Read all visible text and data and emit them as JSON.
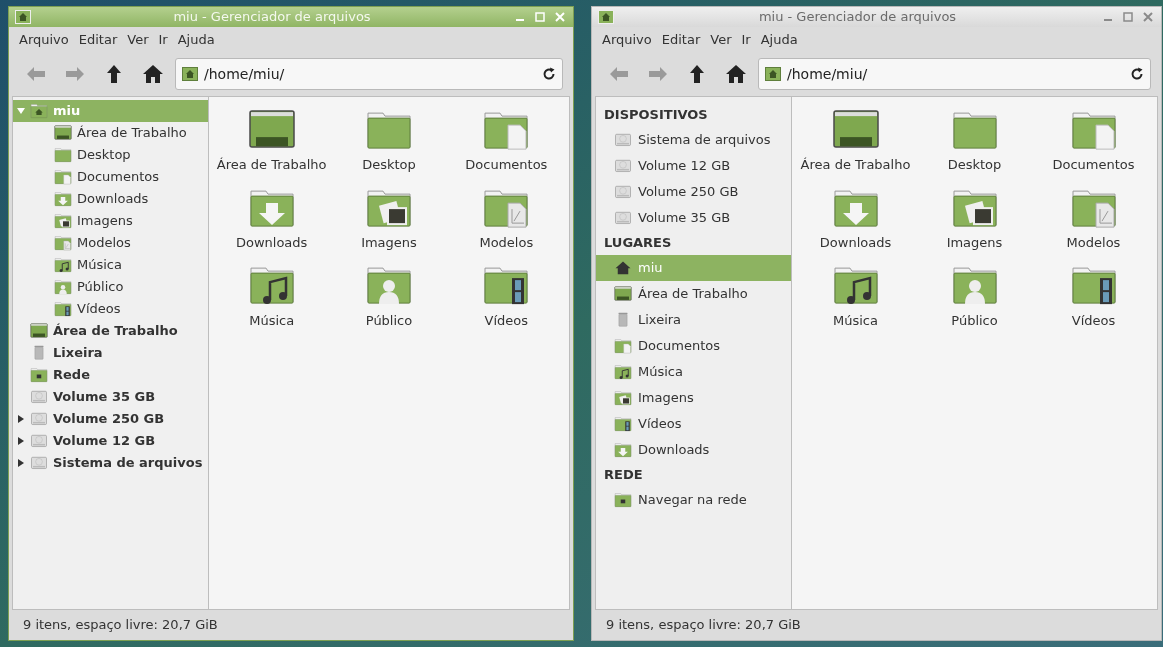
{
  "windows": [
    {
      "active": true,
      "title": "miu - Gerenciador de arquivos",
      "menu": [
        "Arquivo",
        "Editar",
        "Ver",
        "Ir",
        "Ajuda"
      ],
      "path": "/home/miu/",
      "sidebar": {
        "kind": "tree",
        "items": [
          {
            "label": "miu",
            "kind": "home",
            "selected": true,
            "expanded": true,
            "children": [
              {
                "label": "Área de Trabalho",
                "kind": "desktop",
                "selected": false
              },
              {
                "label": "Desktop",
                "kind": "folder",
                "selected": false
              },
              {
                "label": "Documentos",
                "kind": "documents",
                "selected": false
              },
              {
                "label": "Downloads",
                "kind": "downloads",
                "selected": false
              },
              {
                "label": "Imagens",
                "kind": "pictures",
                "selected": false
              },
              {
                "label": "Modelos",
                "kind": "templates",
                "selected": false
              },
              {
                "label": "Música",
                "kind": "music",
                "selected": false
              },
              {
                "label": "Público",
                "kind": "public",
                "selected": false
              },
              {
                "label": "Vídeos",
                "kind": "videos",
                "selected": false
              }
            ]
          },
          {
            "label": "Área de Trabalho",
            "kind": "desktop",
            "selected": false
          },
          {
            "label": "Lixeira",
            "kind": "trash",
            "selected": false
          },
          {
            "label": "Rede",
            "kind": "network",
            "selected": false
          },
          {
            "label": "Volume 35 GB",
            "kind": "drive",
            "selected": false
          },
          {
            "label": "Volume 250 GB",
            "kind": "drive",
            "selected": false,
            "expanded": false
          },
          {
            "label": "Volume 12 GB",
            "kind": "drive",
            "selected": false,
            "expanded": false
          },
          {
            "label": "Sistema de arquivos",
            "kind": "drive",
            "selected": false,
            "expanded": false
          }
        ]
      },
      "files": [
        {
          "label": "Área de Trabalho",
          "kind": "desktop"
        },
        {
          "label": "Desktop",
          "kind": "folder"
        },
        {
          "label": "Documentos",
          "kind": "documents"
        },
        {
          "label": "Downloads",
          "kind": "downloads"
        },
        {
          "label": "Imagens",
          "kind": "pictures"
        },
        {
          "label": "Modelos",
          "kind": "templates"
        },
        {
          "label": "Música",
          "kind": "music"
        },
        {
          "label": "Público",
          "kind": "public"
        },
        {
          "label": "Vídeos",
          "kind": "videos"
        }
      ],
      "status": "9 itens, espaço livre: 20,7 GiB"
    },
    {
      "active": false,
      "title": "miu - Gerenciador de arquivos",
      "menu": [
        "Arquivo",
        "Editar",
        "Ver",
        "Ir",
        "Ajuda"
      ],
      "path": "/home/miu/",
      "sidebar": {
        "kind": "places",
        "sections": [
          {
            "heading": "DISPOSITIVOS",
            "items": [
              {
                "label": "Sistema de arquivos",
                "kind": "drive",
                "selected": false
              },
              {
                "label": "Volume 12 GB",
                "kind": "drive",
                "selected": false
              },
              {
                "label": "Volume 250 GB",
                "kind": "drive",
                "selected": false
              },
              {
                "label": "Volume 35 GB",
                "kind": "drive",
                "selected": false
              }
            ]
          },
          {
            "heading": "LUGARES",
            "items": [
              {
                "label": "miu",
                "kind": "home_arrow",
                "selected": true
              },
              {
                "label": "Área de Trabalho",
                "kind": "desktop",
                "selected": false
              },
              {
                "label": "Lixeira",
                "kind": "trash",
                "selected": false
              },
              {
                "label": "Documentos",
                "kind": "documents",
                "selected": false
              },
              {
                "label": "Música",
                "kind": "music",
                "selected": false
              },
              {
                "label": "Imagens",
                "kind": "pictures",
                "selected": false
              },
              {
                "label": "Vídeos",
                "kind": "videos",
                "selected": false
              },
              {
                "label": "Downloads",
                "kind": "downloads",
                "selected": false
              }
            ]
          },
          {
            "heading": "REDE",
            "items": [
              {
                "label": "Navegar na rede",
                "kind": "network",
                "selected": false
              }
            ]
          }
        ]
      },
      "files": [
        {
          "label": "Área de Trabalho",
          "kind": "desktop"
        },
        {
          "label": "Desktop",
          "kind": "folder"
        },
        {
          "label": "Documentos",
          "kind": "documents"
        },
        {
          "label": "Downloads",
          "kind": "downloads"
        },
        {
          "label": "Imagens",
          "kind": "pictures"
        },
        {
          "label": "Modelos",
          "kind": "templates"
        },
        {
          "label": "Música",
          "kind": "music"
        },
        {
          "label": "Público",
          "kind": "public"
        },
        {
          "label": "Vídeos",
          "kind": "videos"
        }
      ],
      "status": "9 itens, espaço livre: 20,7 GiB"
    }
  ]
}
